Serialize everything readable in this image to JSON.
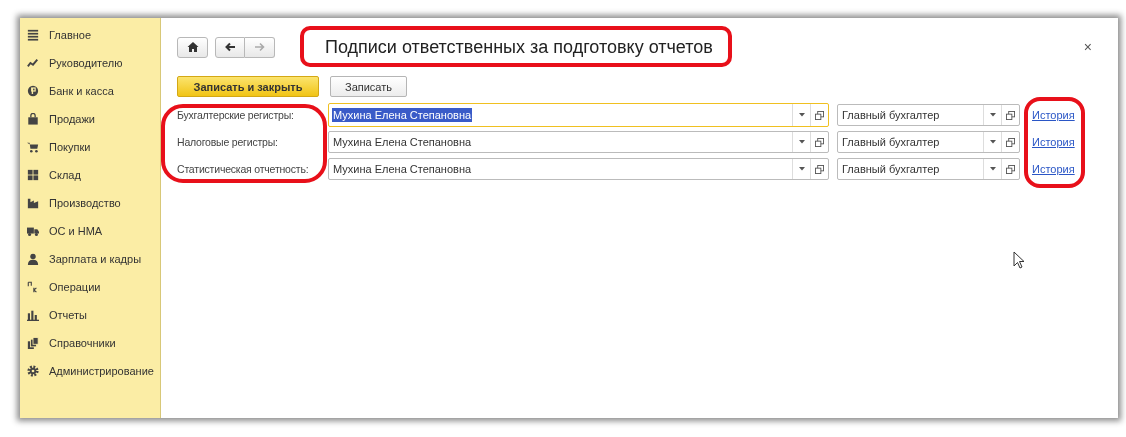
{
  "sidebar": {
    "items": [
      {
        "label": "Главное"
      },
      {
        "label": "Руководителю"
      },
      {
        "label": "Банк и касса"
      },
      {
        "label": "Продажи"
      },
      {
        "label": "Покупки"
      },
      {
        "label": "Склад"
      },
      {
        "label": "Производство"
      },
      {
        "label": "ОС и НМА"
      },
      {
        "label": "Зарплата и кадры"
      },
      {
        "label": "Операции"
      },
      {
        "label": "Отчеты"
      },
      {
        "label": "Справочники"
      },
      {
        "label": "Администрирование"
      }
    ]
  },
  "form": {
    "title": "Подписи ответственных за подготовку отчетов",
    "close": "×",
    "buttons": [
      {
        "label": "Записать и закрыть",
        "kind": "primary"
      },
      {
        "label": "Записать",
        "kind": "default"
      }
    ],
    "rows": [
      {
        "label": "Бухгалтерские регистры:",
        "person": "Мухина Елена Степановна",
        "position": "Главный бухгалтер",
        "link": "История",
        "focused": true
      },
      {
        "label": "Налоговые регистры:",
        "person": "Мухина Елена Степановна",
        "position": "Главный бухгалтер",
        "link": "История",
        "focused": false
      },
      {
        "label": "Статистическая отчетность:",
        "person": "Мухина Елена Степановна",
        "position": "Главный бухгалтер",
        "link": "История",
        "focused": false
      }
    ]
  }
}
